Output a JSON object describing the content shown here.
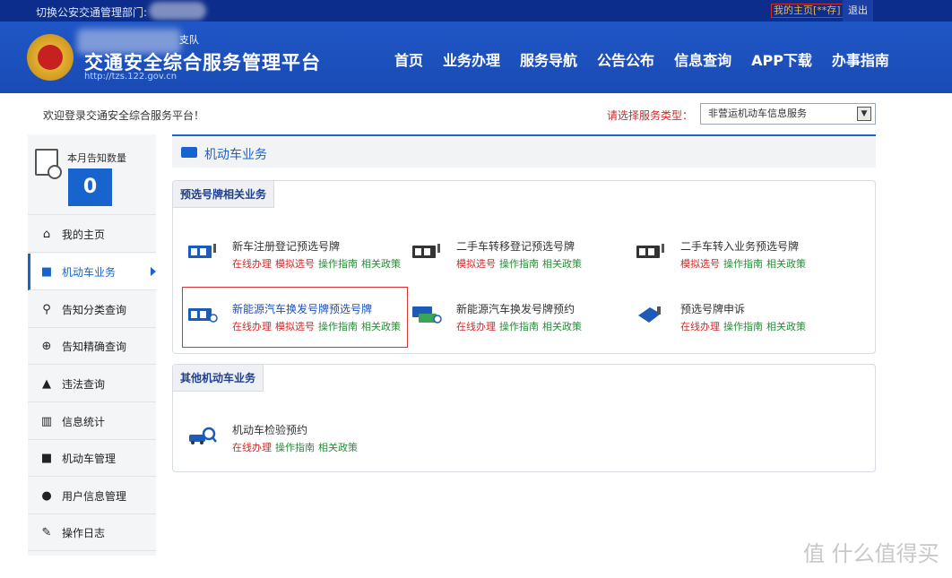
{
  "topbar": {
    "dept_label": "切换公安交通管理部门:",
    "home_link": "我的主页[**存]",
    "logout": "退出"
  },
  "header": {
    "subtitle": "支队",
    "title": "交通安全综合服务管理平台",
    "url": "http://tzs.122.gov.cn",
    "nav": [
      "首页",
      "业务办理",
      "服务导航",
      "公告公布",
      "信息查询",
      "APP下载",
      "办事指南"
    ]
  },
  "welcome": "欢迎登录交通安全综合服务平台！",
  "service_type": {
    "label": "请选择服务类型：",
    "selected": "非营运机动车信息服务"
  },
  "sidebar": {
    "count_label": "本月告知数量",
    "count_value": "0",
    "items": [
      {
        "label": "我的主页",
        "icon": "home-icon"
      },
      {
        "label": "机动车业务",
        "icon": "truck-icon"
      },
      {
        "label": "告知分类查询",
        "icon": "search-icon"
      },
      {
        "label": "告知精确查询",
        "icon": "zoom-icon"
      },
      {
        "label": "违法查询",
        "icon": "warning-icon"
      },
      {
        "label": "信息统计",
        "icon": "chart-icon"
      },
      {
        "label": "机动车管理",
        "icon": "truck-icon"
      },
      {
        "label": "用户信息管理",
        "icon": "user-icon"
      },
      {
        "label": "操作日志",
        "icon": "log-icon"
      }
    ]
  },
  "main": {
    "title": "机动车业务",
    "panel1": {
      "title": "预选号牌相关业务",
      "services": [
        {
          "name": "新车注册登记预选号牌",
          "links": [
            "在线办理",
            "模拟选号",
            "操作指南",
            "相关政策"
          ]
        },
        {
          "name": "二手车转移登记预选号牌",
          "links": [
            "模拟选号",
            "操作指南",
            "相关政策"
          ]
        },
        {
          "name": "二手车转入业务预选号牌",
          "links": [
            "模拟选号",
            "操作指南",
            "相关政策"
          ]
        },
        {
          "name": "新能源汽车换发号牌预选号牌",
          "links": [
            "在线办理",
            "模拟选号",
            "操作指南",
            "相关政策"
          ]
        },
        {
          "name": "新能源汽车换发号牌预约",
          "links": [
            "在线办理",
            "操作指南",
            "相关政策"
          ]
        },
        {
          "name": "预选号牌申诉",
          "links": [
            "在线办理",
            "操作指南",
            "相关政策"
          ]
        }
      ]
    },
    "panel2": {
      "title": "其他机动车业务",
      "services": [
        {
          "name": "机动车检验预约",
          "links": [
            "在线办理",
            "操作指南",
            "相关政策"
          ]
        }
      ]
    }
  },
  "watermark": "值 什么值得买"
}
